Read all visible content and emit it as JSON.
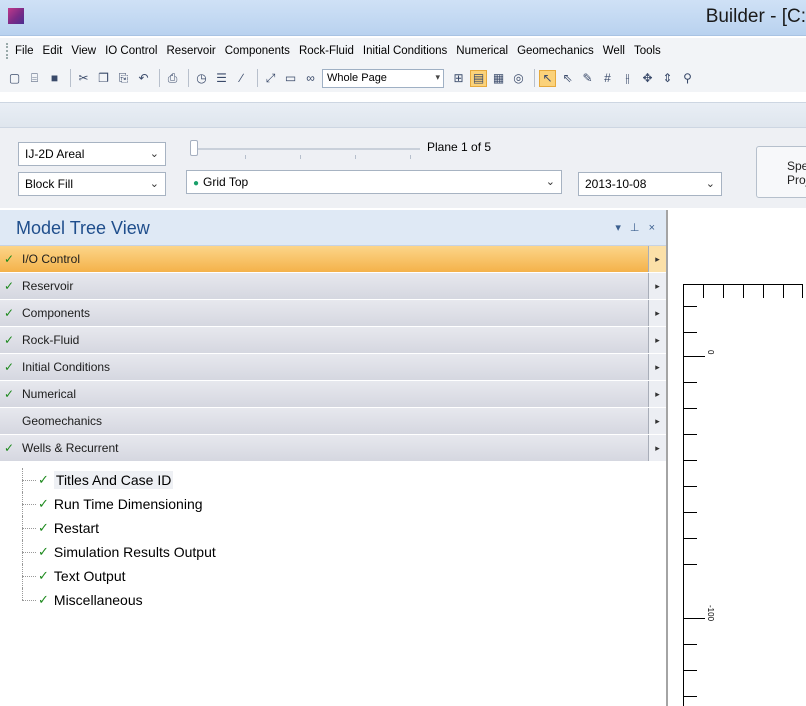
{
  "window": {
    "title": "Builder - [C:"
  },
  "menu": {
    "items": [
      "File",
      "Edit",
      "View",
      "IO Control",
      "Reservoir",
      "Components",
      "Rock-Fluid",
      "Initial Conditions",
      "Numerical",
      "Geomechanics",
      "Well",
      "Tools"
    ]
  },
  "toolbar": {
    "zoom_value": "Whole Page"
  },
  "controls": {
    "view_mode": "IJ-2D Areal",
    "display_type": "Block Fill",
    "plane_label": "Plane 1 of 5",
    "property": "Grid Top",
    "date": "2013-10-08",
    "spec_button_line1": "Spe",
    "spec_button_line2": "Proj"
  },
  "tree": {
    "title": "Model Tree View",
    "header_buttons": "▾ ⊥ ×",
    "sections": [
      {
        "label": "I/O Control",
        "checked": "✓"
      },
      {
        "label": "Reservoir",
        "checked": "✓"
      },
      {
        "label": "Components",
        "checked": "✓"
      },
      {
        "label": "Rock-Fluid",
        "checked": "✓"
      },
      {
        "label": "Initial Conditions",
        "checked": "✓"
      },
      {
        "label": "Numerical",
        "checked": "✓"
      },
      {
        "label": "Geomechanics",
        "checked": ""
      },
      {
        "label": "Wells & Recurrent",
        "checked": "✓"
      }
    ],
    "children": [
      "Titles And Case ID",
      "Run Time Dimensioning",
      "Restart",
      "Simulation Results Output",
      "Text Output",
      "Miscellaneous"
    ]
  },
  "viewport": {
    "ruler_labels": [
      "0",
      "-100"
    ]
  },
  "colors": {
    "active_section": "#f4b24a",
    "check_green": "#1e8a1e",
    "tree_title": "#1f4e8c"
  }
}
